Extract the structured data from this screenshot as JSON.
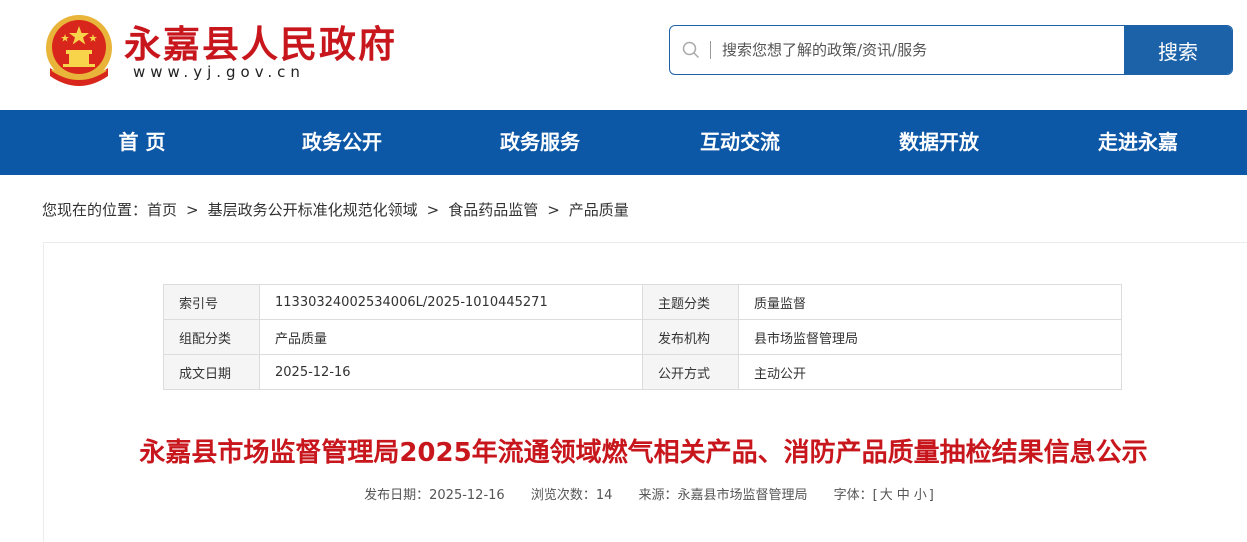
{
  "header": {
    "site_title": "永嘉县人民政府",
    "site_url": "www.yj.gov.cn",
    "brand_color": "#c8161d"
  },
  "search": {
    "placeholder": "搜索您想了解的政策/资讯/服务",
    "button_label": "搜索",
    "accent_color": "#1c62a8"
  },
  "nav": {
    "items": [
      {
        "label": "首 页"
      },
      {
        "label": "政务公开"
      },
      {
        "label": "政务服务"
      },
      {
        "label": "互动交流"
      },
      {
        "label": "数据开放"
      },
      {
        "label": "走进永嘉"
      }
    ]
  },
  "breadcrumb": {
    "prefix": "您现在的位置：",
    "items": [
      "首页",
      "基层政务公开标准化规范化领域",
      "食品药品监管",
      "产品质量"
    ],
    "separator": ">"
  },
  "meta_table": {
    "rows": [
      {
        "k1": "索引号",
        "v1": "11330324002534006L/2025-1010445271",
        "k2": "主题分类",
        "v2": "质量监督"
      },
      {
        "k1": "组配分类",
        "v1": "产品质量",
        "k2": "发布机构",
        "v2": "县市场监督管理局"
      },
      {
        "k1": "成文日期",
        "v1": "2025-12-16",
        "k2": "公开方式",
        "v2": "主动公开"
      }
    ]
  },
  "article": {
    "title": "永嘉县市场监督管理局2025年流通领域燃气相关产品、消防产品质量抽检结果信息公示",
    "publish_date": "发布日期：2025-12-16",
    "views": "浏览次数：14",
    "source": "来源：永嘉县市场监督管理局",
    "font_label": "字体：[",
    "font_large": "大",
    "font_medium": "中",
    "font_small": "小",
    "font_close": "]"
  }
}
